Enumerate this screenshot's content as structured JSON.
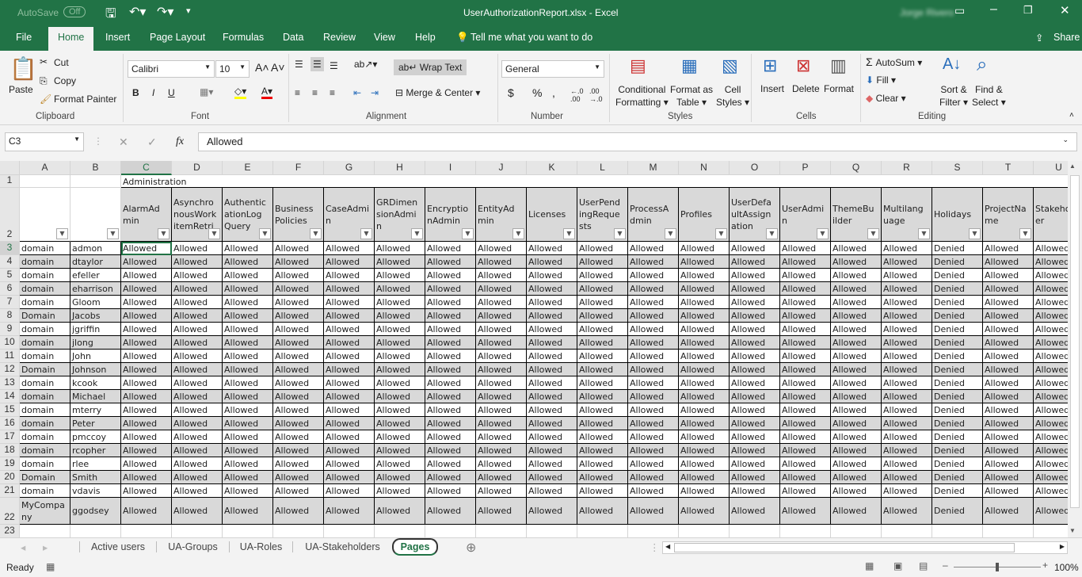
{
  "titlebar": {
    "autosave": "AutoSave",
    "autosave_state": "Off",
    "title": "UserAuthorizationReport.xlsx  -  Excel",
    "user": "Jorge Rivero"
  },
  "tabs": [
    "File",
    "Home",
    "Insert",
    "Page Layout",
    "Formulas",
    "Data",
    "Review",
    "View",
    "Help"
  ],
  "tellme": "Tell me what you want to do",
  "share": "Share",
  "ribbon": {
    "clipboard": {
      "paste": "Paste",
      "cut": "Cut",
      "copy": "Copy",
      "format_painter": "Format Painter",
      "label": "Clipboard"
    },
    "font": {
      "name": "Calibri",
      "size": "10",
      "bold": "B",
      "italic": "I",
      "underline": "U",
      "label": "Font"
    },
    "alignment": {
      "wrap": "Wrap Text",
      "merge": "Merge & Center",
      "label": "Alignment"
    },
    "number": {
      "format": "General",
      "currency": "$",
      "percent": "%",
      "comma": ",",
      "label": "Number"
    },
    "styles": {
      "cond1": "Conditional",
      "cond2": "Formatting",
      "fmt1": "Format as",
      "fmt2": "Table",
      "cell1": "Cell",
      "cell2": "Styles",
      "label": "Styles"
    },
    "cells": {
      "insert": "Insert",
      "delete": "Delete",
      "format": "Format",
      "label": "Cells"
    },
    "editing": {
      "autosum": "AutoSum",
      "fill": "Fill",
      "clear": "Clear",
      "sort1": "Sort &",
      "sort2": "Filter",
      "find1": "Find &",
      "find2": "Select",
      "label": "Editing"
    }
  },
  "formula": {
    "namebox": "C3",
    "value": "Allowed",
    "fx": "fx"
  },
  "columns": [
    "A",
    "B",
    "C",
    "D",
    "E",
    "F",
    "G",
    "H",
    "I",
    "J",
    "K",
    "L",
    "M",
    "N",
    "O",
    "P",
    "Q",
    "R",
    "S",
    "T",
    "U"
  ],
  "row1_title": "Administration",
  "headers": [
    "",
    "",
    "AlarmAdmin",
    "AsynchronousWorkitemRetrieval",
    "AuthenticationLogQuery",
    "BusinessPolicies",
    "CaseAdmin",
    "GRDimensionAdmin",
    "EncryptionAdmin",
    "EntityAdmin",
    "Licenses",
    "UserPendingRequests",
    "ProcessAdmin",
    "Profiles",
    "UserDefaultAssignation",
    "UserAdmin",
    "ThemeBuilder",
    "Multilanguage",
    "Holidays",
    "ProjectName",
    "Stakeholder"
  ],
  "rows": [
    [
      "domain",
      "admon"
    ],
    [
      "domain",
      "dtaylor"
    ],
    [
      "domain",
      "efeller"
    ],
    [
      "domain",
      "eharrison"
    ],
    [
      "domain",
      "Gloom"
    ],
    [
      "Domain",
      "Jacobs"
    ],
    [
      "domain",
      "jgriffin"
    ],
    [
      "domain",
      "jlong"
    ],
    [
      "domain",
      "John"
    ],
    [
      "Domain",
      "Johnson"
    ],
    [
      "domain",
      "kcook"
    ],
    [
      "domain",
      "Michael"
    ],
    [
      "domain",
      "mterry"
    ],
    [
      "domain",
      "Peter"
    ],
    [
      "domain",
      "pmccoy"
    ],
    [
      "domain",
      "rcopher"
    ],
    [
      "domain",
      "rlee"
    ],
    [
      "Domain",
      "Smith"
    ],
    [
      "domain",
      "vdavis"
    ],
    [
      "MyCompany",
      "ggodsey"
    ]
  ],
  "values": {
    "default": "Allowed",
    "holidays": "Denied"
  },
  "sheets": [
    "Active users",
    "UA-Groups",
    "UA-Roles",
    "UA-Stakeholders",
    "Pages"
  ],
  "active_sheet": "Pages",
  "status": {
    "ready": "Ready",
    "zoom": "100%"
  },
  "colors": {
    "accent": "#217346",
    "header_fill": "#d9d9d9"
  }
}
